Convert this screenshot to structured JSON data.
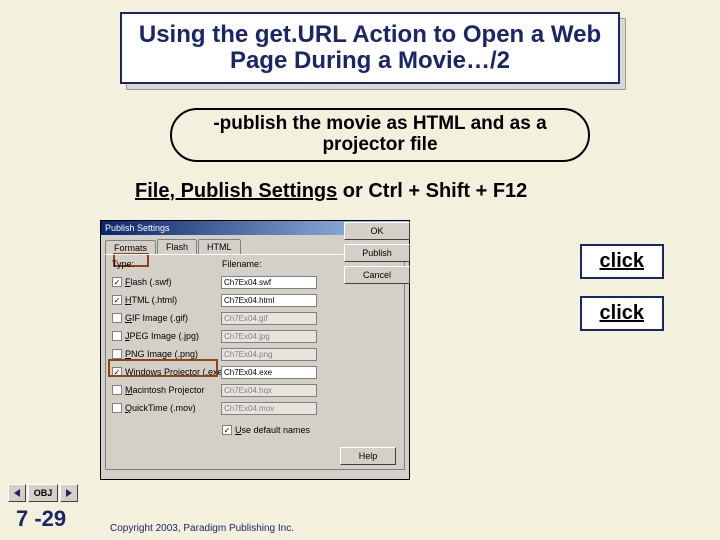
{
  "title": "Using the get.URL Action to Open a Web Page During a Movie…/2",
  "subtitle": "-publish the movie as HTML and as a projector file",
  "instruction_prefix": "F",
  "instruction_text": "ile, Publish Settings",
  "instruction_suffix": " or Ctrl + Shift + F12",
  "dialog": {
    "title": "Publish Settings",
    "tabs": {
      "formats": "Formats",
      "flash": "Flash",
      "html": "HTML"
    },
    "headers": {
      "type": "Type:",
      "filename": "Filename:"
    },
    "rows": [
      {
        "label_u": "F",
        "label_rest": "lash (.swf)",
        "checked": true,
        "disabled": false,
        "fn": "Ch7Ex04.swf"
      },
      {
        "label_u": "H",
        "label_rest": "TML (.html)",
        "checked": true,
        "disabled": false,
        "fn": "Ch7Ex04.html"
      },
      {
        "label_u": "G",
        "label_rest": "IF Image (.gif)",
        "checked": false,
        "disabled": true,
        "fn": "Ch7Ex04.gif"
      },
      {
        "label_u": "J",
        "label_rest": "PEG Image (.jpg)",
        "checked": false,
        "disabled": true,
        "fn": "Ch7Ex04.jpg"
      },
      {
        "label_u": "P",
        "label_rest": "NG Image (.png)",
        "checked": false,
        "disabled": true,
        "fn": "Ch7Ex04.png"
      },
      {
        "label_u": "W",
        "label_rest": "indows Projector (.exe)",
        "checked": true,
        "disabled": false,
        "fn": "Ch7Ex04.exe"
      },
      {
        "label_u": "M",
        "label_rest": "acintosh Projector",
        "checked": false,
        "disabled": true,
        "fn": "Ch7Ex04.hqx"
      },
      {
        "label_u": "Q",
        "label_rest": "uickTime (.mov)",
        "checked": false,
        "disabled": true,
        "fn": "Ch7Ex04.mov"
      }
    ],
    "defaultnames_u": "U",
    "defaultnames_rest": "se default names",
    "defaultnames_checked": true,
    "buttons": {
      "ok": "OK",
      "publish": "Publish",
      "cancel": "Cancel",
      "help": "Help"
    }
  },
  "callouts": {
    "c1": "click",
    "c2": "click"
  },
  "nav": {
    "obj": "OBJ"
  },
  "page": "7 -29",
  "copyright": "Copyright 2003, Paradigm Publishing Inc."
}
